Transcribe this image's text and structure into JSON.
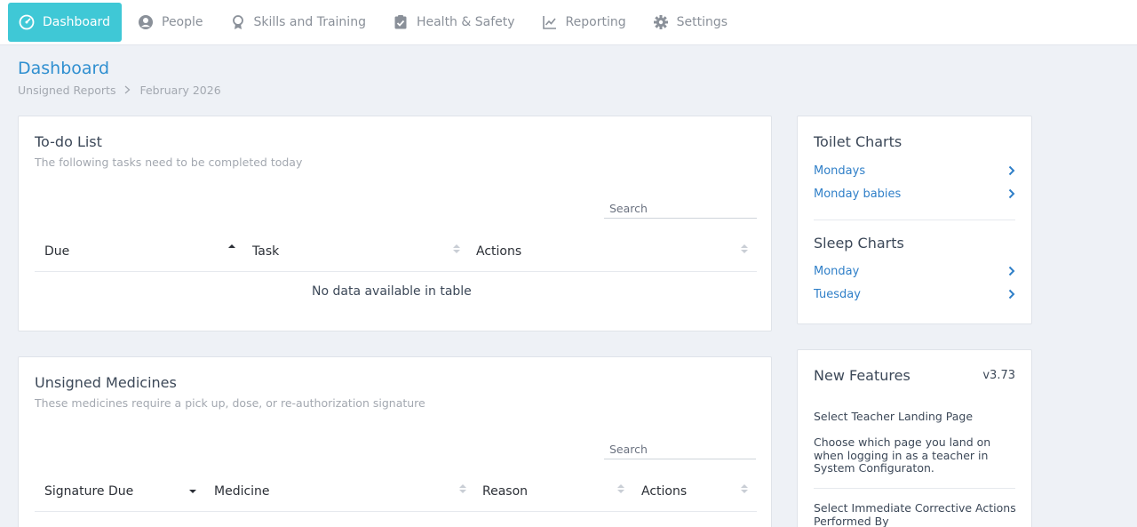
{
  "nav": {
    "items": [
      {
        "label": "Dashboard",
        "icon": "gauge-icon"
      },
      {
        "label": "People",
        "icon": "user-circle-icon"
      },
      {
        "label": "Skills and Training",
        "icon": "award-icon"
      },
      {
        "label": "Health & Safety",
        "icon": "clipboard-check-icon"
      },
      {
        "label": "Reporting",
        "icon": "line-chart-icon"
      },
      {
        "label": "Settings",
        "icon": "gear-icon"
      }
    ]
  },
  "page": {
    "title": "Dashboard",
    "breadcrumb": [
      "Unsigned Reports",
      "February 2026"
    ]
  },
  "todo": {
    "title": "To-do List",
    "subtitle": "The following tasks need to be completed today",
    "search_placeholder": "Search",
    "columns": [
      "Due",
      "Task",
      "Actions"
    ],
    "empty": "No data available in table"
  },
  "medicines": {
    "title": "Unsigned Medicines",
    "subtitle": "These medicines require a pick up, dose, or re-authorization signature",
    "search_placeholder": "Search",
    "columns": [
      "Signature Due",
      "Medicine",
      "Reason",
      "Actions"
    ]
  },
  "toilet": {
    "title": "Toilet Charts",
    "links": [
      "Mondays",
      "Monday babies"
    ]
  },
  "sleep": {
    "title": "Sleep Charts",
    "links": [
      "Monday",
      "Tuesday"
    ]
  },
  "features": {
    "title": "New Features",
    "version": "v3.73",
    "items": [
      {
        "heading": "Select Teacher Landing Page",
        "body": "Choose which page you land on when logging in as a teacher in System Configuraton."
      },
      {
        "heading": "Select Immediate Corrective Actions Performed By"
      }
    ]
  },
  "colors": {
    "accent": "#3fc8d6",
    "link": "#2f7fc8",
    "title": "#2f8fd0",
    "background": "#eef1f6"
  }
}
